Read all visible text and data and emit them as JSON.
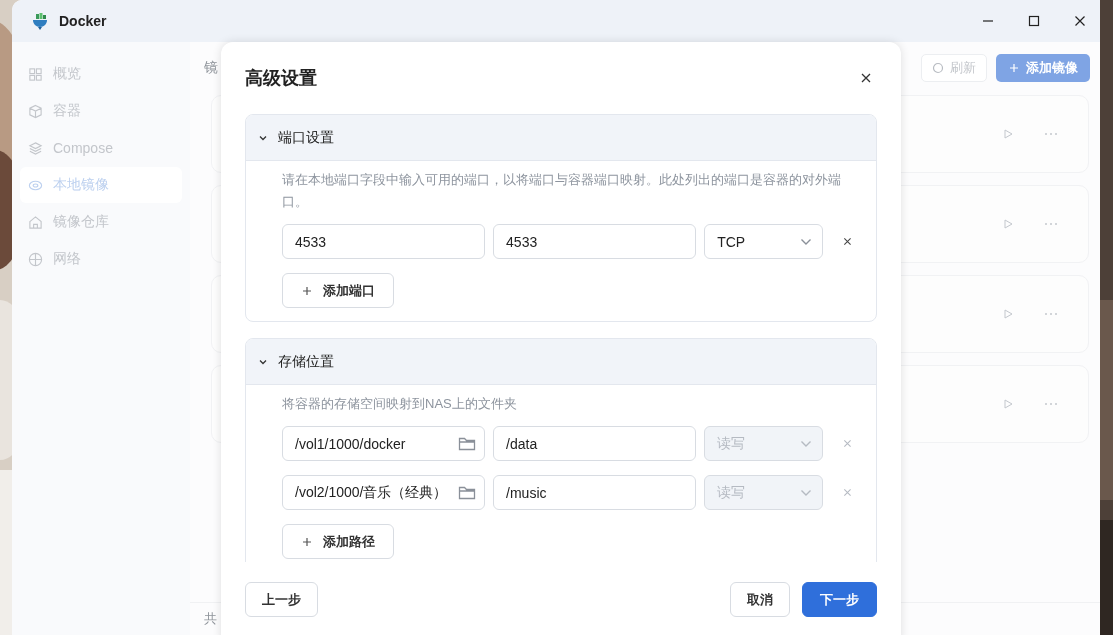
{
  "window": {
    "title": "Docker"
  },
  "sidebar": {
    "items": [
      {
        "label": "概览",
        "selected": false
      },
      {
        "label": "容器",
        "selected": false
      },
      {
        "label": "Compose",
        "selected": false
      },
      {
        "label": "本地镜像",
        "selected": true
      },
      {
        "label": "镜像仓库",
        "selected": false
      },
      {
        "label": "网络",
        "selected": false
      }
    ]
  },
  "main": {
    "heading": "镜",
    "refresh_button": "刷新",
    "add_button": "添加镜像",
    "footer_text": "共"
  },
  "dialog": {
    "title": "高级设置",
    "sections": [
      {
        "title": "端口设置",
        "expanded": true,
        "description": "请在本地端口字段中输入可用的端口，以将端口与容器端口映射。此处列出的端口是容器的对外端口。",
        "rows": [
          {
            "kind": "port",
            "first": "4533",
            "second": "4533",
            "option": "TCP",
            "disabled": false
          }
        ],
        "add_button": "添加端口"
      },
      {
        "title": "存储位置",
        "expanded": true,
        "description": "将容器的存储空间映射到NAS上的文件夹",
        "rows": [
          {
            "kind": "volume",
            "first": "/vol1/1000/docker",
            "second": "/data",
            "option": "读写",
            "disabled": true
          },
          {
            "kind": "volume",
            "first": "/vol2/1000/音乐（经典）",
            "second": "/music",
            "option": "读写",
            "disabled": true
          }
        ],
        "add_button": "添加路径"
      }
    ],
    "back_button": "上一步",
    "cancel_button": "取消",
    "next_button": "下一步"
  }
}
